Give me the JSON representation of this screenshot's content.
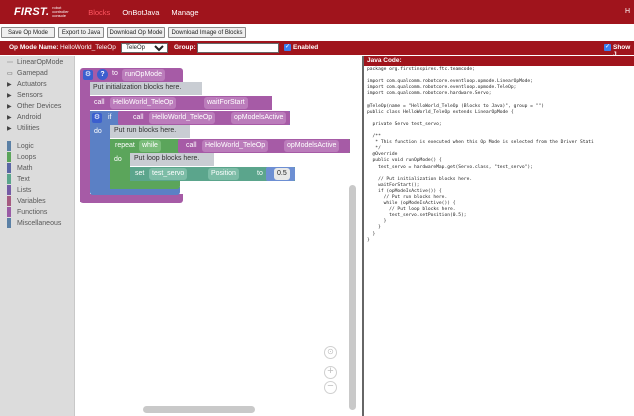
{
  "topbar": {
    "logo_main": "FIRST.",
    "logo_sub": "robot controller console",
    "tabs": [
      "Blocks",
      "OnBotJava",
      "Manage"
    ],
    "right": "H"
  },
  "toolbar": {
    "buttons": [
      "Save Op Mode",
      "Export to Java",
      "Download Op Mode",
      "Download Image of Blocks"
    ]
  },
  "opmode": {
    "name_label": "Op Mode Name:",
    "name_value": "HelloWorld_TeleOp",
    "type_selected": "TeleOp",
    "group_label": "Group:",
    "group_value": "",
    "enabled_label": "Enabled",
    "show_label": "Show J"
  },
  "sidebar": {
    "items": [
      {
        "pre": "⋯",
        "label": "LinearOpMode",
        "color": ""
      },
      {
        "pre": "▭",
        "label": "Gamepad",
        "color": ""
      },
      {
        "pre": "▶",
        "label": "Actuators",
        "color": ""
      },
      {
        "pre": "▶",
        "label": "Sensors",
        "color": ""
      },
      {
        "pre": "▶",
        "label": "Other Devices",
        "color": ""
      },
      {
        "pre": "▶",
        "label": "Android",
        "color": ""
      },
      {
        "pre": "▶",
        "label": "Utilities",
        "color": ""
      },
      {
        "pre": "",
        "label": "Logic",
        "color": "#5b80a5"
      },
      {
        "pre": "",
        "label": "Loops",
        "color": "#5ba55b"
      },
      {
        "pre": "",
        "label": "Math",
        "color": "#5b67a5"
      },
      {
        "pre": "",
        "label": "Text",
        "color": "#5ba58c"
      },
      {
        "pre": "",
        "label": "Lists",
        "color": "#745ba5"
      },
      {
        "pre": "",
        "label": "Variables",
        "color": "#a55b80"
      },
      {
        "pre": "",
        "label": "Functions",
        "color": "#995ba5"
      },
      {
        "pre": "",
        "label": "Miscellaneous",
        "color": "#5b80a5"
      }
    ]
  },
  "blocks": {
    "to": "to",
    "func_name": "runOpMode",
    "comment1": "Put initialization blocks here.",
    "call": "call",
    "class1": "HelloWorld_TeleOp",
    "wait": "waitForStart",
    "if": "if",
    "call2": "call",
    "class2": "HelloWorld_TeleOp",
    "active1": "opModelsActive",
    "do": "do",
    "comment2": "Put run blocks here.",
    "repeat": "repeat",
    "while": "while",
    "call3": "call",
    "class3": "HelloWorld_TeleOp",
    "active2": "opModelsActive",
    "do2": "do",
    "comment3": "Put loop blocks here.",
    "set": "set",
    "servo": "test_servo",
    "position": "Position",
    "to2": "to",
    "value": "0.5"
  },
  "java": {
    "title": "Java Code:",
    "code": "package org.firstinspires.ftc.teamcode;\n\nimport com.qualcomm.robotcore.eventloop.opmode.LinearOpMode;\nimport com.qualcomm.robotcore.eventloop.opmode.TeleOp;\nimport com.qualcomm.robotcore.hardware.Servo;\n\n@TeleOp(name = \"HelloWorld_TeleOp (Blocks to Java)\", group = \"\")\npublic class HelloWorld_TeleOp extends LinearOpMode {\n\n  private Servo test_servo;\n\n  /**\n   * This function is executed when this Op Mode is selected from the Driver Stati\n   */\n  @Override\n  public void runOpMode() {\n    test_servo = hardwareMap.get(Servo.class, \"test_servo\");\n\n    // Put initialization blocks here.\n    waitForStart();\n    if (opModeIsActive()) {\n      // Put run blocks here.\n      while (opModeIsActive()) {\n        // Put loop blocks here.\n        test_servo.setPosition(0.5);\n      }\n    }\n  }\n}"
  },
  "colors": {
    "brand_red": "#a0141c",
    "procedure": "#a65ba6",
    "logic": "#5b80c5",
    "loop": "#5ba55b",
    "servo": "#5ba58c"
  }
}
